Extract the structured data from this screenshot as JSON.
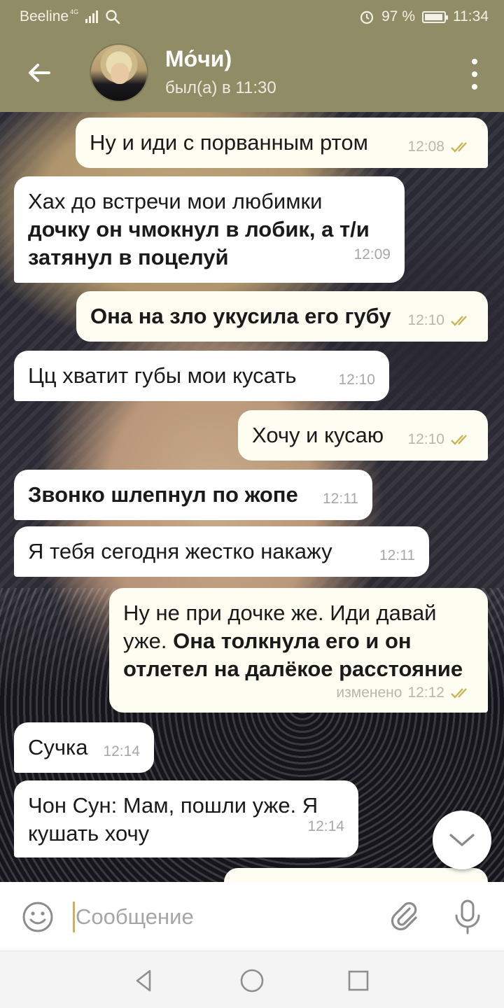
{
  "status_bar": {
    "carrier": "Beeline",
    "network": "4G",
    "battery": "97 %",
    "battery_level": 0.97,
    "time": "11:34",
    "icons": [
      "search-icon",
      "signal-icon",
      "alarm-icon",
      "battery-icon"
    ]
  },
  "header": {
    "name": "Мо́чи)",
    "status": "был(а) в 11:30",
    "icons": [
      "back-arrow-icon",
      "avatar",
      "more-vert-icon"
    ]
  },
  "messages": [
    {
      "dir": "out",
      "text": "Ну и иди с порванным ртом",
      "bold": "",
      "time": "12:08",
      "edited": ""
    },
    {
      "dir": "in",
      "text": "Хах до встречи мои любимки",
      "bold": "дочку он чмокнул в лобик, а т/и затянул в поцелуй",
      "time": "12:09",
      "edited": ""
    },
    {
      "dir": "out",
      "text": "",
      "bold": "Она на зло укусила его губу",
      "time": "12:10",
      "edited": ""
    },
    {
      "dir": "in",
      "text": "Цц хватит губы мои кусать",
      "bold": "",
      "time": "12:10",
      "edited": ""
    },
    {
      "dir": "out",
      "text": "Хочу и кусаю",
      "bold": "",
      "time": "12:10",
      "edited": ""
    },
    {
      "dir": "in",
      "text": "",
      "bold": "Звонко шлепнул по жопе",
      "time": "12:11",
      "edited": ""
    },
    {
      "dir": "in",
      "text": "Я тебя сегодня жестко накажу",
      "bold": "",
      "time": "12:11",
      "edited": ""
    },
    {
      "dir": "out",
      "text": "Ну не при дочке же. Иди давай уже.",
      "bold": "Она толкнула его и он отлетел на далёкое расстояние",
      "time": "12:12",
      "edited": "изменено"
    },
    {
      "dir": "in",
      "text": "Сучка",
      "bold": "",
      "time": "12:14",
      "edited": ""
    },
    {
      "dir": "in",
      "text": "Чон Сун: Мам, пошли уже. Я кушать хочу",
      "bold": "",
      "time": "12:14",
      "edited": ""
    }
  ],
  "composer": {
    "placeholder": "Сообщение",
    "icons": [
      "emoji-icon",
      "attach-icon",
      "mic-icon"
    ]
  },
  "nav": {
    "icons": [
      "back-triangle-icon",
      "home-circle-icon",
      "recents-square-icon"
    ]
  },
  "colors": {
    "header": "#8f8c66",
    "bubble_out": "#fefdf1",
    "bubble_in": "#ffffff",
    "check": "#c9b556",
    "cursor": "#c9b556"
  }
}
